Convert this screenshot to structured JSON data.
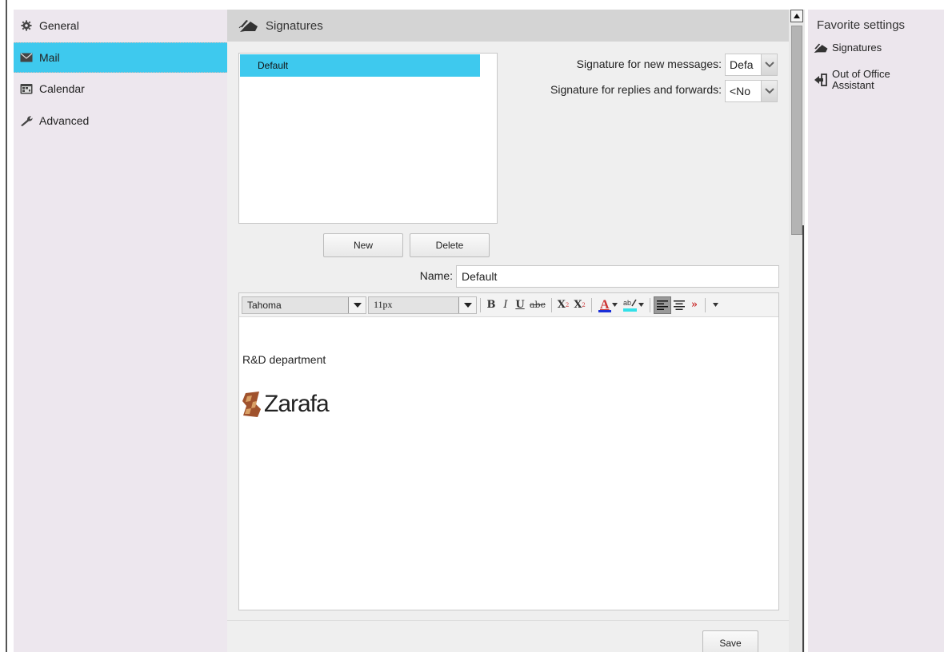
{
  "nav": {
    "items": [
      {
        "label": "General",
        "icon": "gear-icon"
      },
      {
        "label": "Mail",
        "icon": "mail-icon",
        "active": true
      },
      {
        "label": "Calendar",
        "icon": "calendar-icon"
      },
      {
        "label": "Advanced",
        "icon": "wrench-icon"
      }
    ]
  },
  "main": {
    "header_title": "Signatures",
    "signature_list": [
      "Default"
    ],
    "new_label": "New",
    "delete_label": "Delete",
    "new_messages_label": "Signature for new messages:",
    "new_messages_value": "Defa",
    "replies_label": "Signature for replies and forwards:",
    "replies_value": "<No",
    "name_label": "Name:",
    "name_value": "Default",
    "toolbar": {
      "font_family": "Tahoma",
      "font_size": "11px",
      "bold": "B",
      "italic": "I",
      "underline": "U",
      "strike": "abc",
      "superscript_base": "X",
      "subscript_base": "X",
      "more": "»"
    },
    "editor_text": "R&D department",
    "logo_text": "Zarafa",
    "save_label": "Save"
  },
  "favorites": {
    "title": "Favorite settings",
    "items": [
      {
        "label": "Signatures",
        "icon": "signature-icon"
      },
      {
        "label": "Out of Office Assistant",
        "icon": "out-of-office-icon"
      }
    ]
  },
  "colors": {
    "accent": "#3ec9ee",
    "nav_bg": "#ede7ee",
    "header_bg": "#d4d4d4",
    "panel_bg": "#efefef"
  }
}
